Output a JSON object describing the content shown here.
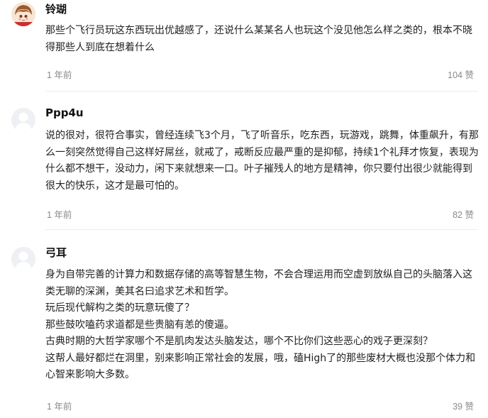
{
  "comments": [
    {
      "author": "铃瑚",
      "content": [
        "那些个飞行员玩这东西玩出优越感了，还说什么某某名人也玩这个没见他怎么样之类的，根本不晓得那些人到底在想着什么"
      ],
      "time": "1 年前",
      "likes": "104 赞",
      "avatar": "user-photo"
    },
    {
      "author": "Ppp4u",
      "content": [
        "说的很对，很符合事实，曾经连续飞3个月，飞了听音乐，吃东西，玩游戏，跳舞，体重飙升，有那么一刻突然觉得自己这样好屌丝，就戒了，戒断反应最严重的是抑郁，持续1个礼拜才恢复，表现为什么都不想干，没动力，闲下来就想来一口。叶子摧残人的地方是精神，你只要付出很少就能得到很大的快乐，这才是最可怕的。"
      ],
      "time": "1 年前",
      "likes": "82 赞",
      "avatar": "default-user-icon"
    },
    {
      "author": "弓耳",
      "content": [
        "身为自带完善的计算力和数据存储的高等智慧生物，不会合理运用而空虚到放纵自己的头脑落入这类无聊的深渊，美其名曰追求艺术和哲学。",
        "玩后现代解构之类的玩意玩傻了？",
        "那些鼓吹嗑药求道都是些贵脑有恙的傻逼。",
        "古典时期的大哲学家哪个不是肌肉发达头脑发达，哪个不比你们这些恶心的戏子更深刻？",
        "这帮人最好都烂在洞里，别来影响正常社会的发展，哦，磕High了的那些废材大概也没那个体力和心智来影响大多数。"
      ],
      "time": "1 年前",
      "likes": "39 赞",
      "avatar": "default-user-icon"
    }
  ]
}
